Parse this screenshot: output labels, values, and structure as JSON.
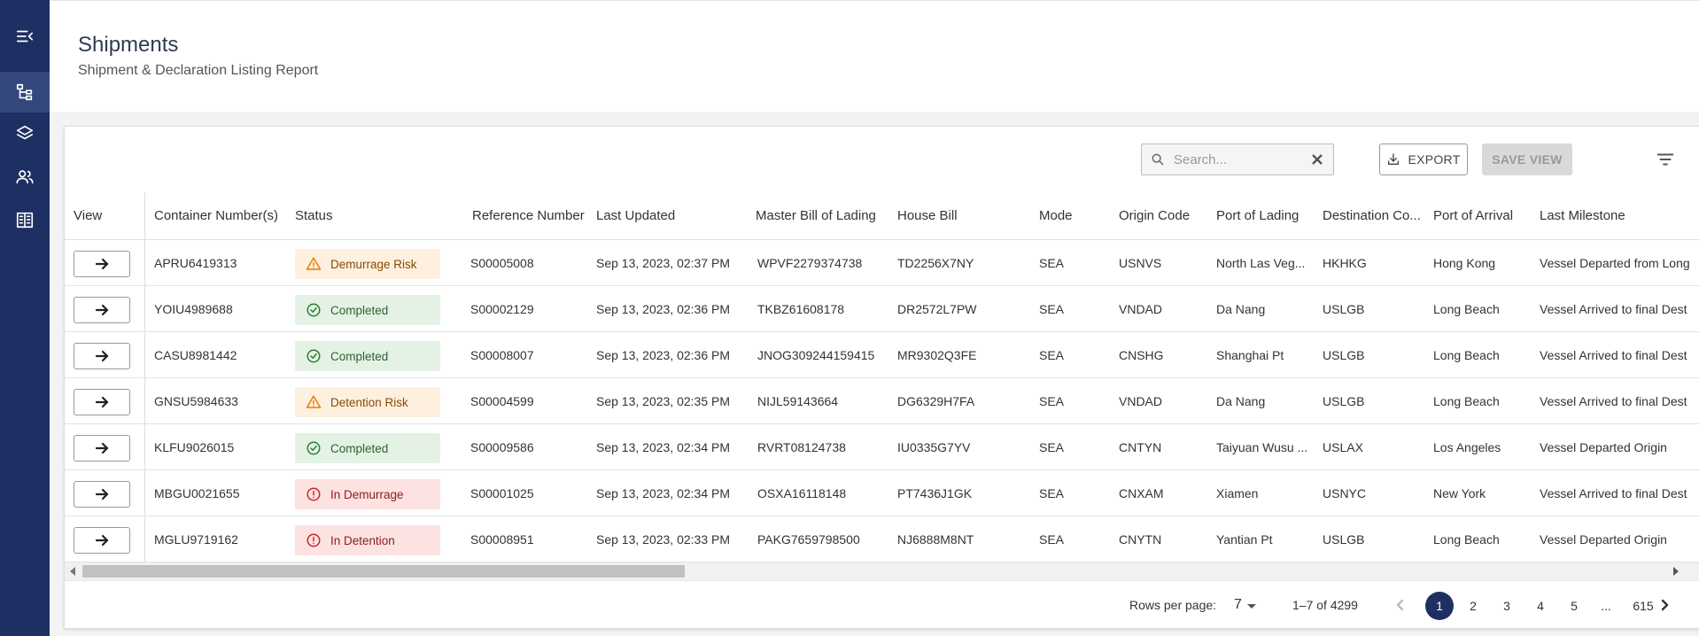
{
  "header": {
    "title": "Shipments",
    "subtitle": "Shipment & Declaration Listing Report"
  },
  "sidebar": {
    "items": [
      {
        "icon": "menu-collapse-icon"
      },
      {
        "icon": "hierarchy-icon",
        "active": true
      },
      {
        "icon": "layers-icon"
      },
      {
        "icon": "users-icon"
      },
      {
        "icon": "building-icon"
      }
    ]
  },
  "toolbar": {
    "search_placeholder": "Search...",
    "export_label": "EXPORT",
    "save_view_label": "SAVE VIEW"
  },
  "table": {
    "columns": [
      "View",
      "Container Number(s)",
      "Status",
      "Reference Number",
      "Last Updated",
      "Master Bill of Lading",
      "House Bill",
      "Mode",
      "Origin Code",
      "Port of Lading",
      "Destination Co...",
      "Port of Arrival",
      "Last Milestone"
    ],
    "rows": [
      {
        "container": "APRU6419313",
        "status": "Demurrage Risk",
        "status_type": "warning",
        "reference": "S00005008",
        "updated": "Sep 13, 2023, 02:37 PM",
        "mbl": "WPVF2279374738",
        "house": "TD2256X7NY",
        "mode": "SEA",
        "origin": "USNVS",
        "lading": "North Las Veg...",
        "dest": "HKHKG",
        "arrival": "Hong Kong",
        "milestone": "Vessel Departed from Long"
      },
      {
        "container": "YOIU4989688",
        "status": "Completed",
        "status_type": "success",
        "reference": "S00002129",
        "updated": "Sep 13, 2023, 02:36 PM",
        "mbl": "TKBZ61608178",
        "house": "DR2572L7PW",
        "mode": "SEA",
        "origin": "VNDAD",
        "lading": "Da Nang",
        "dest": "USLGB",
        "arrival": "Long Beach",
        "milestone": "Vessel Arrived to final Dest"
      },
      {
        "container": "CASU8981442",
        "status": "Completed",
        "status_type": "success",
        "reference": "S00008007",
        "updated": "Sep 13, 2023, 02:36 PM",
        "mbl": "JNOG309244159415",
        "house": "MR9302Q3FE",
        "mode": "SEA",
        "origin": "CNSHG",
        "lading": "Shanghai Pt",
        "dest": "USLGB",
        "arrival": "Long Beach",
        "milestone": "Vessel Arrived to final Dest"
      },
      {
        "container": "GNSU5984633",
        "status": "Detention Risk",
        "status_type": "warning",
        "reference": "S00004599",
        "updated": "Sep 13, 2023, 02:35 PM",
        "mbl": "NIJL59143664",
        "house": "DG6329H7FA",
        "mode": "SEA",
        "origin": "VNDAD",
        "lading": "Da Nang",
        "dest": "USLGB",
        "arrival": "Long Beach",
        "milestone": "Vessel Arrived to final Dest"
      },
      {
        "container": "KLFU9026015",
        "status": "Completed",
        "status_type": "success",
        "reference": "S00009586",
        "updated": "Sep 13, 2023, 02:34 PM",
        "mbl": "RVRT08124738",
        "house": "IU0335G7YV",
        "mode": "SEA",
        "origin": "CNTYN",
        "lading": "Taiyuan Wusu ...",
        "dest": "USLAX",
        "arrival": "Los Angeles",
        "milestone": "Vessel Departed Origin"
      },
      {
        "container": "MBGU0021655",
        "status": "In Demurrage",
        "status_type": "error",
        "reference": "S00001025",
        "updated": "Sep 13, 2023, 02:34 PM",
        "mbl": "OSXA16118148",
        "house": "PT7436J1GK",
        "mode": "SEA",
        "origin": "CNXAM",
        "lading": "Xiamen",
        "dest": "USNYC",
        "arrival": "New York",
        "milestone": "Vessel Arrived to final Dest"
      },
      {
        "container": "MGLU9719162",
        "status": "In Detention",
        "status_type": "error",
        "reference": "S00008951",
        "updated": "Sep 13, 2023, 02:33 PM",
        "mbl": "PAKG7659798500",
        "house": "NJ6888M8NT",
        "mode": "SEA",
        "origin": "CNYTN",
        "lading": "Yantian Pt",
        "dest": "USLGB",
        "arrival": "Long Beach",
        "milestone": "Vessel Departed Origin"
      }
    ]
  },
  "pagination": {
    "rows_per_page_label": "Rows per page:",
    "rows_per_page": "7",
    "range": "1–7 of 4299",
    "pages": [
      "1",
      "2",
      "3",
      "4",
      "5",
      "...",
      "615"
    ],
    "current": "1"
  },
  "colors": {
    "sidebar": "#1e2f63",
    "accent": "#1e2f63",
    "warning": "#e67e00",
    "success": "#2e7d32",
    "error": "#c62828"
  }
}
